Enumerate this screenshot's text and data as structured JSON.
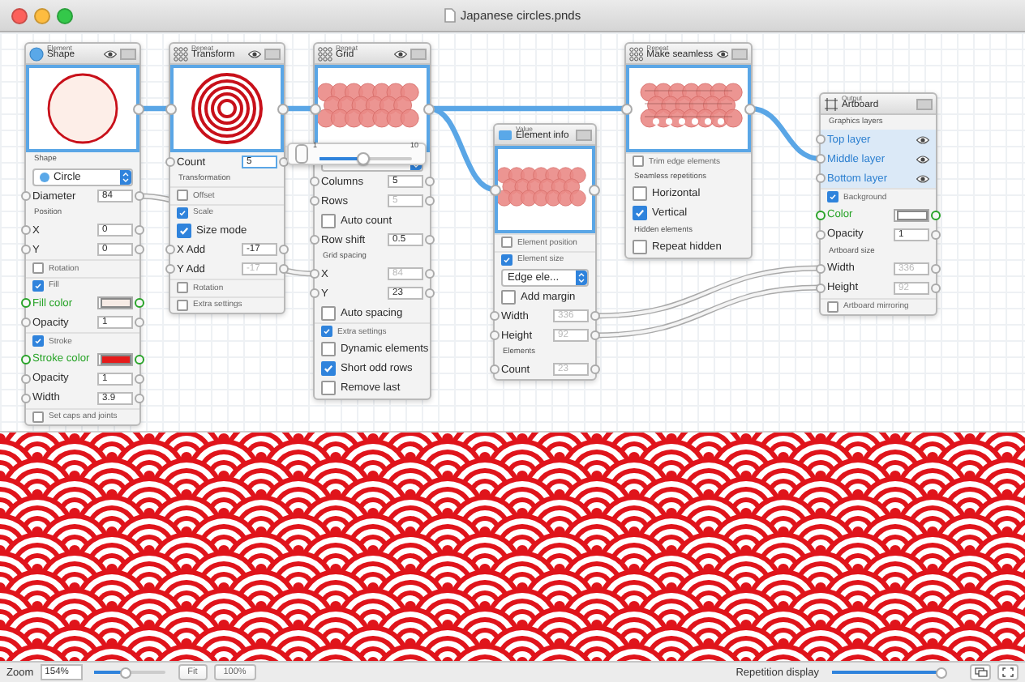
{
  "window": {
    "title": "Japanese circles.pnds"
  },
  "nodes": [
    {
      "category": "Element",
      "title": "Shape",
      "eye": true,
      "rows": [
        {
          "kind": "section",
          "label": "Shape"
        },
        {
          "kind": "dropdown",
          "value": "Circle"
        },
        {
          "kind": "field",
          "label": "Diameter",
          "value": "84",
          "disabled": false
        },
        {
          "kind": "section",
          "label": "Position"
        },
        {
          "kind": "field",
          "label": "X",
          "value": "0",
          "disabled": false
        },
        {
          "kind": "field",
          "label": "Y",
          "value": "0",
          "disabled": false
        },
        {
          "kind": "toggle",
          "label": "Rotation",
          "checked": false
        },
        {
          "kind": "toggle",
          "label": "Fill",
          "checked": true
        },
        {
          "kind": "color",
          "label": "Fill color",
          "color": "#f7ebe5",
          "active": true
        },
        {
          "kind": "field",
          "label": "Opacity",
          "value": "1",
          "disabled": false
        },
        {
          "kind": "toggle",
          "label": "Stroke",
          "checked": true
        },
        {
          "kind": "color",
          "label": "Stroke color",
          "color": "#e51b1b",
          "active": true
        },
        {
          "kind": "field",
          "label": "Opacity",
          "value": "1",
          "disabled": false
        },
        {
          "kind": "field",
          "label": "Width",
          "value": "3.9",
          "disabled": false
        },
        {
          "kind": "toggle",
          "label": "Set caps and joints",
          "checked": false
        }
      ]
    },
    {
      "category": "Repeat",
      "title": "Transform",
      "eye": true,
      "rows": [
        {
          "kind": "field",
          "label": "Count",
          "value": "5",
          "disabled": false,
          "focused": true
        },
        {
          "kind": "section",
          "label": "Transformation"
        },
        {
          "kind": "toggle",
          "label": "Offset",
          "checked": false
        },
        {
          "kind": "toggle",
          "label": "Scale",
          "checked": true
        },
        {
          "kind": "check",
          "label": "Size mode",
          "checked": true
        },
        {
          "kind": "field",
          "label": "X Add",
          "value": "-17",
          "disabled": false
        },
        {
          "kind": "field",
          "label": "Y Add",
          "value": "-17",
          "disabled": true
        },
        {
          "kind": "toggle",
          "label": "Rotation",
          "checked": false
        },
        {
          "kind": "toggle",
          "label": "Extra settings",
          "checked": false
        }
      ]
    },
    {
      "category": "Repeat",
      "title": "Grid",
      "eye": true,
      "rows": [
        {
          "kind": "dropdown"
        },
        {
          "kind": "field",
          "label": "Columns",
          "value": "5",
          "disabled": false
        },
        {
          "kind": "field",
          "label": "Rows",
          "value": "5",
          "disabled": true
        },
        {
          "kind": "check",
          "label": "Auto count",
          "checked": false
        },
        {
          "kind": "field",
          "label": "Row shift",
          "value": "0.5",
          "disabled": false
        },
        {
          "kind": "section",
          "label": "Grid spacing"
        },
        {
          "kind": "field",
          "label": "X",
          "value": "84",
          "disabled": true
        },
        {
          "kind": "field",
          "label": "Y",
          "value": "23",
          "disabled": false
        },
        {
          "kind": "check",
          "label": "Auto spacing",
          "checked": false
        },
        {
          "kind": "toggle",
          "label": "Extra settings",
          "checked": true
        },
        {
          "kind": "check",
          "label": "Dynamic elements",
          "checked": false
        },
        {
          "kind": "check",
          "label": "Short odd rows",
          "checked": true
        },
        {
          "kind": "check",
          "label": "Remove last",
          "checked": false
        }
      ]
    },
    {
      "category": "Value",
      "title": "Element info",
      "eye": false,
      "rows": [
        {
          "kind": "toggle",
          "label": "Element position",
          "checked": false
        },
        {
          "kind": "toggle",
          "label": "Element size",
          "checked": true
        },
        {
          "kind": "dropdown",
          "value": "Edge ele..."
        },
        {
          "kind": "check",
          "label": "Add margin",
          "checked": false
        },
        {
          "kind": "field",
          "label": "Width",
          "value": "336",
          "disabled": true
        },
        {
          "kind": "field",
          "label": "Height",
          "value": "92",
          "disabled": true
        },
        {
          "kind": "section",
          "label": "Elements"
        },
        {
          "kind": "field",
          "label": "Count",
          "value": "23",
          "disabled": true
        }
      ]
    },
    {
      "category": "Repeat",
      "title": "Make seamless",
      "eye": true,
      "rows": [
        {
          "kind": "toggle",
          "label": "Trim edge elements",
          "checked": false
        },
        {
          "kind": "section",
          "label": "Seamless repetitions"
        },
        {
          "kind": "check",
          "label": "Horizontal",
          "checked": false
        },
        {
          "kind": "check",
          "label": "Vertical",
          "checked": true
        },
        {
          "kind": "section",
          "label": "Hidden elements"
        },
        {
          "kind": "check",
          "label": "Repeat hidden",
          "checked": false
        }
      ]
    },
    {
      "category": "Output",
      "title": "Artboard",
      "eye": false,
      "rows": [
        {
          "kind": "section",
          "label": "Graphics layers"
        },
        {
          "kind": "layer",
          "label": "Top layer",
          "visible": true
        },
        {
          "kind": "layer",
          "label": "Middle layer",
          "visible": true
        },
        {
          "kind": "layer",
          "label": "Bottom layer",
          "visible": true
        },
        {
          "kind": "toggle",
          "label": "Background",
          "checked": true
        },
        {
          "kind": "color",
          "label": "Color",
          "color": "#ffffff",
          "active": true
        },
        {
          "kind": "field",
          "label": "Opacity",
          "value": "1",
          "disabled": false
        },
        {
          "kind": "section",
          "label": "Artboard size"
        },
        {
          "kind": "field",
          "label": "Width",
          "value": "336",
          "disabled": true
        },
        {
          "kind": "field",
          "label": "Height",
          "value": "92",
          "disabled": true
        },
        {
          "kind": "toggle",
          "label": "Artboard mirroring",
          "checked": false
        }
      ]
    }
  ],
  "popup": {
    "min": "1",
    "max": "10",
    "level": 0.47
  },
  "status_bar": {
    "zoom": {
      "label": "Zoom",
      "value": "154%",
      "level": 0.45
    },
    "buttons": [
      "Fit",
      "100%"
    ],
    "repetition": {
      "label": "Repetition display",
      "level": 1.0
    }
  }
}
